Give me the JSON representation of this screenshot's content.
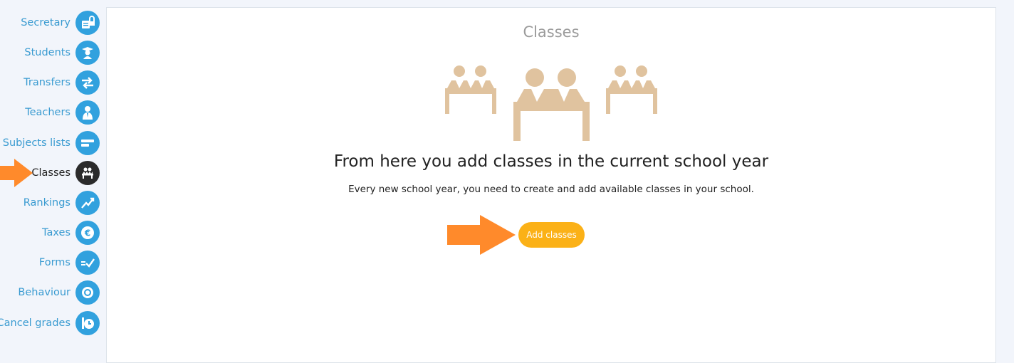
{
  "sidebar": {
    "items": [
      {
        "label": "Secretary",
        "icon": "secretary-icon"
      },
      {
        "label": "Students",
        "icon": "graduate-icon"
      },
      {
        "label": "Transfers",
        "icon": "transfer-arrows-icon"
      },
      {
        "label": "Teachers",
        "icon": "teacher-icon"
      },
      {
        "label": "Subjects lists",
        "icon": "list-bars-icon"
      },
      {
        "label": "Classes",
        "icon": "classroom-icon",
        "active": true
      },
      {
        "label": "Rankings",
        "icon": "trend-chart-icon"
      },
      {
        "label": "Taxes",
        "icon": "euro-icon"
      },
      {
        "label": "Forms",
        "icon": "form-check-icon"
      },
      {
        "label": "Behaviour",
        "icon": "badge-icon"
      },
      {
        "label": "Cancel grades",
        "icon": "cancel-timer-icon"
      }
    ]
  },
  "main": {
    "title": "Classes",
    "headline": "From here you add classes in the current school year",
    "subline": "Every new school year, you need to create and add available classes in your school.",
    "add_button_label": "Add classes"
  },
  "colors": {
    "accent_blue": "#31a1de",
    "active_icon": "#2b2b2b",
    "button": "#fbb117",
    "highlight_arrow": "#ff8a2b",
    "illustration": "#e0c39f"
  }
}
